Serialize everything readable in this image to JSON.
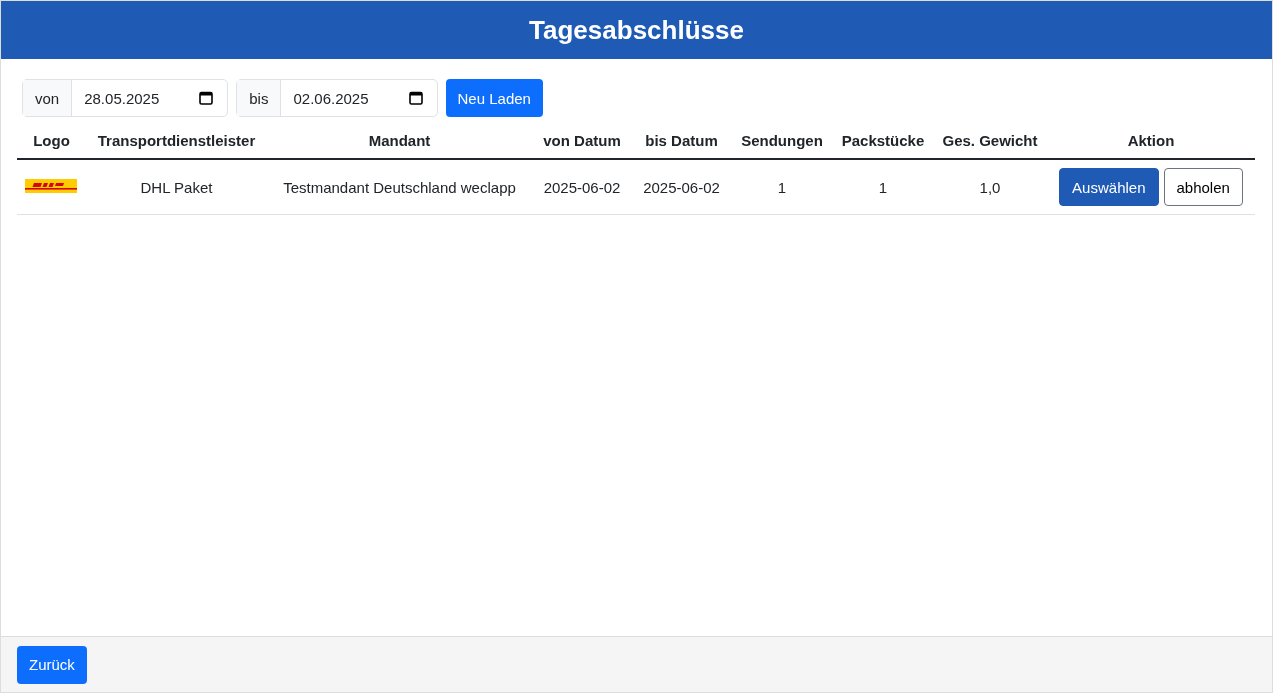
{
  "header": {
    "title": "Tagesabschlüsse"
  },
  "filters": [
    {
      "label": "von",
      "value": "28.05.2025"
    },
    {
      "label": "bis",
      "value": "02.06.2025"
    }
  ],
  "reload_button": "Neu Laden",
  "table": {
    "columns": [
      "Logo",
      "Transportdienstleister",
      "Mandant",
      "von Datum",
      "bis Datum",
      "Sendungen",
      "Packstücke",
      "Ges. Gewicht",
      "Aktion"
    ],
    "rows": [
      {
        "carrier": "DHL Paket",
        "client": "Testmandant Deutschland weclapp",
        "from": "2025-06-02",
        "to": "2025-06-02",
        "shipments": "1",
        "parcels": "1",
        "weight": "1,0",
        "actions": [
          {
            "label": "Auswählen",
            "kind": "primary"
          },
          {
            "label": "abholen",
            "kind": "outline"
          }
        ]
      }
    ]
  },
  "footer": {
    "back_button": "Zurück"
  }
}
